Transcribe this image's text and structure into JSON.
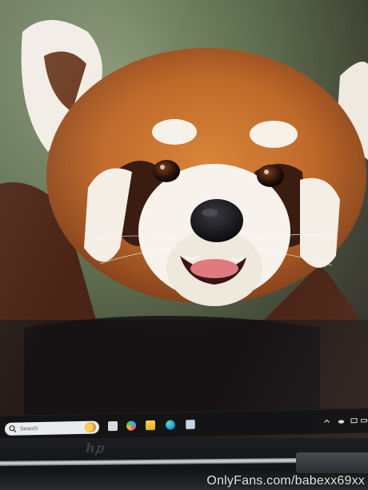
{
  "taskbar": {
    "search_placeholder": "Search",
    "pinned_icons": [
      "task-view-icon",
      "copilot-icon",
      "file-explorer-icon",
      "edge-icon",
      "calendar-icon"
    ],
    "tray_icons": [
      "chevron-up-icon",
      "cloud-icon",
      "battery-icon",
      "display-icon"
    ]
  },
  "device": {
    "brand_logo": "hp"
  },
  "watermark": {
    "text": "OnlyFans.com/babexx69xx"
  }
}
